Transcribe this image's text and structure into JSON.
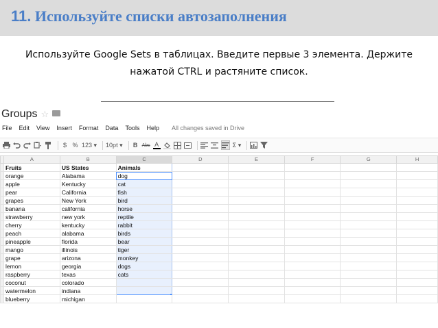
{
  "slide": {
    "number": "11.",
    "title": "Используйте списки автозаполнения",
    "description_line1": "Используйте Google Sets в таблицах. Введите первые 3 элемента. Держите",
    "description_line2": "нажатой CTRL и растяните список."
  },
  "sheet": {
    "doc_title": "Groups",
    "star_icon": "☆",
    "menu": [
      "File",
      "Edit",
      "View",
      "Insert",
      "Format",
      "Data",
      "Tools",
      "Help"
    ],
    "save_status": "All changes saved in Drive",
    "toolbar": {
      "currency": "$",
      "percent": "%",
      "number_format": "123 ▾",
      "font_size": "10pt ▾",
      "bold": "B",
      "strike": "Abc",
      "text_color": "A",
      "sum": "Σ ▾"
    },
    "columns": [
      "A",
      "B",
      "C",
      "D",
      "E",
      "F",
      "G",
      "H"
    ],
    "headers": [
      "Fruits",
      "US States",
      "Animals"
    ],
    "rows": [
      [
        "orange",
        "Alabama",
        "dog"
      ],
      [
        "apple",
        "Kentucky",
        "cat"
      ],
      [
        "pear",
        "California",
        "fish"
      ],
      [
        "grapes",
        "New York",
        "bird"
      ],
      [
        "banana",
        "california",
        "horse"
      ],
      [
        "strawberry",
        "new york",
        "reptile"
      ],
      [
        "cherry",
        "kentucky",
        "rabbit"
      ],
      [
        "peach",
        "alabama",
        "birds"
      ],
      [
        "pineapple",
        "florida",
        "bear"
      ],
      [
        "mango",
        "illinois",
        "tiger"
      ],
      [
        "grape",
        "arizona",
        "monkey"
      ],
      [
        "lemon",
        "georgia",
        "dogs"
      ],
      [
        "raspberry",
        "texas",
        "cats"
      ],
      [
        "coconut",
        "colorado",
        ""
      ],
      [
        "watermelon",
        "indiana",
        ""
      ],
      [
        "blueberry",
        "michigan",
        ""
      ]
    ],
    "colors": {
      "accent": "#4d90fe",
      "title": "#4a7ec7"
    }
  }
}
